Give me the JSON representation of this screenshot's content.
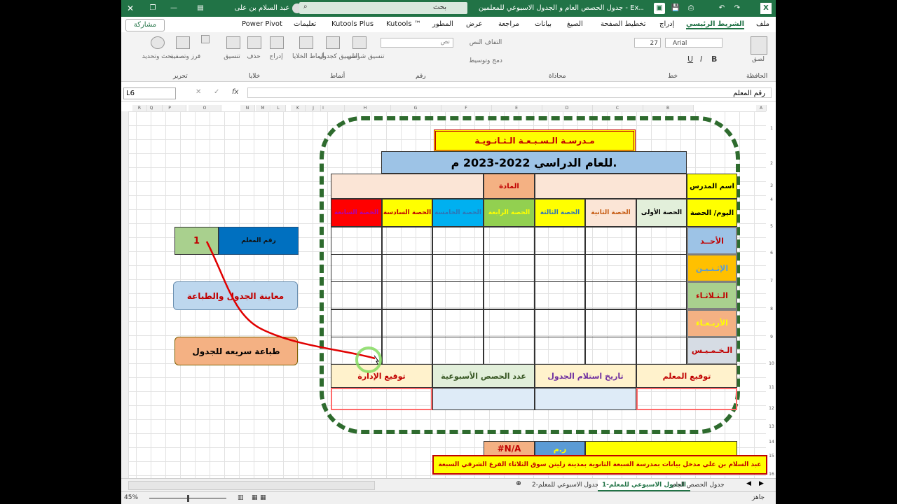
{
  "titlebar": {
    "title": "جدول  الحصص العام  و الجدول الاسبوعي للمعلمين  -  Ex...",
    "search": "بحث",
    "user": "عبد السلام بن على"
  },
  "menu": {
    "share": "مشاركة",
    "tabs": [
      "ملف",
      "الشريط الرئيسي",
      "إدراج",
      "تخطيط الصفحة",
      "الصيغ",
      "بيانات",
      "مراجعة",
      "عرض",
      "المطور",
      "Kutools ™",
      "Kutools Plus",
      "تعليمات",
      "Power Pivot"
    ]
  },
  "ribbon": {
    "groups": [
      "الحافظة",
      "خط",
      "محاذاة",
      "رقم",
      "أنماط",
      "خلايا",
      "تحرير"
    ],
    "font_name": "Arial",
    "font_size": "27",
    "paste": "لصق",
    "insert": "إدراج",
    "delete": "حذف",
    "format": "تنسيق",
    "find": "بحث وتحديد",
    "sort": "فرز وتصفية",
    "cond_format": "تنسيق شرطي",
    "table_format": "التنسيق كجدول",
    "cell_styles": "أنماط الخلايا",
    "wrap": "التفاف النص",
    "merge": "دمج وتوسيط",
    "number_format": "نص"
  },
  "formula_bar": {
    "name_box": "L6",
    "content": "رقم المعلم"
  },
  "columns": [
    "A",
    "B",
    "C",
    "D",
    "E",
    "F",
    "G",
    "H",
    "I",
    "J",
    "K",
    "L",
    "M",
    "N",
    "O",
    "P",
    "Q",
    "R"
  ],
  "schedule": {
    "school": "مـدرسـة الـسـبـعـة الـثـانـويـة",
    "year": "للعام الدراسي 2022-2023 م.",
    "teacher_name_label": "اسم المدرس",
    "subject_label": "المادة",
    "day_period_label": "اليوم/ الحصة",
    "periods": [
      "الحصة الأولى",
      "الحصة الثانية",
      "الحصة الثالثة",
      "الحصة الرابعة",
      "الحصة الخامسة",
      "الحصة السادسة",
      "الحصة السابعة"
    ],
    "days": [
      "الأحــد",
      "الإثـنـيـن",
      "الـثـلاثـاء",
      "الأربـعـاء",
      "الـخـمـيـس"
    ],
    "footer": [
      "توقيع المعلم",
      "تاريخ استلام الجدول",
      "عدد الحصص الأسبوعية",
      "توقيع الإدارة"
    ],
    "na": "#N/A",
    "rm": "ر.م",
    "bottom_line": "عبد السلام بن علي مدخل بيانات بمدرسة السبعة الثانوية بمدينة زليتن سوق الثلاثاء الفرع الشرقي السبعة"
  },
  "side": {
    "teacher_no_label": "رقم المعلم",
    "teacher_no_value": "1",
    "preview_button": "معاينة الجدول والطباعة",
    "quick_print_button": "طباعة سريعه للجدول"
  },
  "sheet_tabs": [
    "جدول الحصص العام",
    "الجدول الاسبوعي للمعلم-1",
    "الجدول الاسبوعي للمعلم-2"
  ],
  "status": {
    "ready": "جاهز",
    "zoom": "45%"
  },
  "colors": {
    "excel_green": "#217346",
    "dash_green": "#2e6b2e"
  }
}
